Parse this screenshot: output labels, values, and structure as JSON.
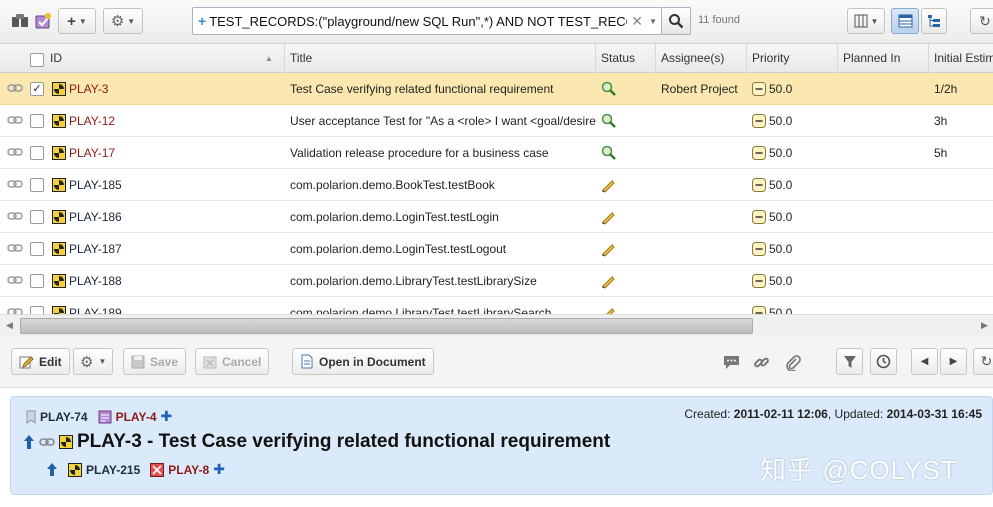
{
  "toolbar": {
    "query_text": "TEST_RECORDS:(\"playground/new SQL Run\",*) AND NOT TEST_RECORDS",
    "found_label": "11 found",
    "icons": [
      "queries-icon",
      "new-query-icon",
      "add-icon",
      "gear-icon",
      "search-icon",
      "columns-icon",
      "table-view-icon",
      "tree-view-icon",
      "refresh-icon"
    ]
  },
  "table": {
    "columns": {
      "id": "ID",
      "title": "Title",
      "status": "Status",
      "assignee": "Assignee(s)",
      "priority": "Priority",
      "planned_in": "Planned In",
      "estimate": "Initial Estimate"
    },
    "rows": [
      {
        "id": "PLAY-3",
        "title": "Test Case verifying related functional requirement",
        "status": "review",
        "assignee": "Robert Project",
        "priority": "50.0",
        "estimate": "1/2h",
        "selected": true,
        "checked": true,
        "id_color": "#8a1a1a"
      },
      {
        "id": "PLAY-12",
        "title": "User acceptance Test for \"As a <role> I want <goal/desire>\"",
        "status": "review",
        "assignee": "",
        "priority": "50.0",
        "estimate": "3h",
        "selected": false,
        "checked": false,
        "id_color": "#8a1a1a"
      },
      {
        "id": "PLAY-17",
        "title": "Validation release procedure for a business case",
        "status": "review",
        "assignee": "",
        "priority": "50.0",
        "estimate": "5h",
        "selected": false,
        "checked": false,
        "id_color": "#8a1a1a"
      },
      {
        "id": "PLAY-185",
        "title": "com.polarion.demo.BookTest.testBook",
        "status": "draft",
        "assignee": "",
        "priority": "50.0",
        "estimate": "",
        "selected": false,
        "checked": false,
        "id_color": "#1d2b3a"
      },
      {
        "id": "PLAY-186",
        "title": "com.polarion.demo.LoginTest.testLogin",
        "status": "draft",
        "assignee": "",
        "priority": "50.0",
        "estimate": "",
        "selected": false,
        "checked": false,
        "id_color": "#1d2b3a"
      },
      {
        "id": "PLAY-187",
        "title": "com.polarion.demo.LoginTest.testLogout",
        "status": "draft",
        "assignee": "",
        "priority": "50.0",
        "estimate": "",
        "selected": false,
        "checked": false,
        "id_color": "#1d2b3a"
      },
      {
        "id": "PLAY-188",
        "title": "com.polarion.demo.LibraryTest.testLibrarySize",
        "status": "draft",
        "assignee": "",
        "priority": "50.0",
        "estimate": "",
        "selected": false,
        "checked": false,
        "id_color": "#1d2b3a"
      },
      {
        "id": "PLAY-189",
        "title": "com.polarion.demo.LibraryTest.testLibrarySearch",
        "status": "draft",
        "assignee": "",
        "priority": "50.0",
        "estimate": "",
        "selected": false,
        "checked": false,
        "id_color": "#1d2b3a"
      }
    ]
  },
  "actions": {
    "edit": "Edit",
    "save": "Save",
    "cancel": "Cancel",
    "open_in_document": "Open in Document"
  },
  "detail": {
    "parent_links": [
      {
        "id": "PLAY-74",
        "color": "#1d2b3a"
      },
      {
        "id": "PLAY-4",
        "color": "#8a1a1a"
      }
    ],
    "created_label": "Created:",
    "created_value": "2011-02-11 12:06",
    "updated_label": ", Updated:",
    "updated_value": "2014-03-31 16:45",
    "title": "PLAY-3 - Test Case verifying related functional requirement",
    "child_links": [
      {
        "id": "PLAY-215",
        "color": "#1d2b3a"
      },
      {
        "id": "PLAY-8",
        "color": "#8a1a1a"
      }
    ]
  },
  "watermark": "知乎 @COLYST"
}
